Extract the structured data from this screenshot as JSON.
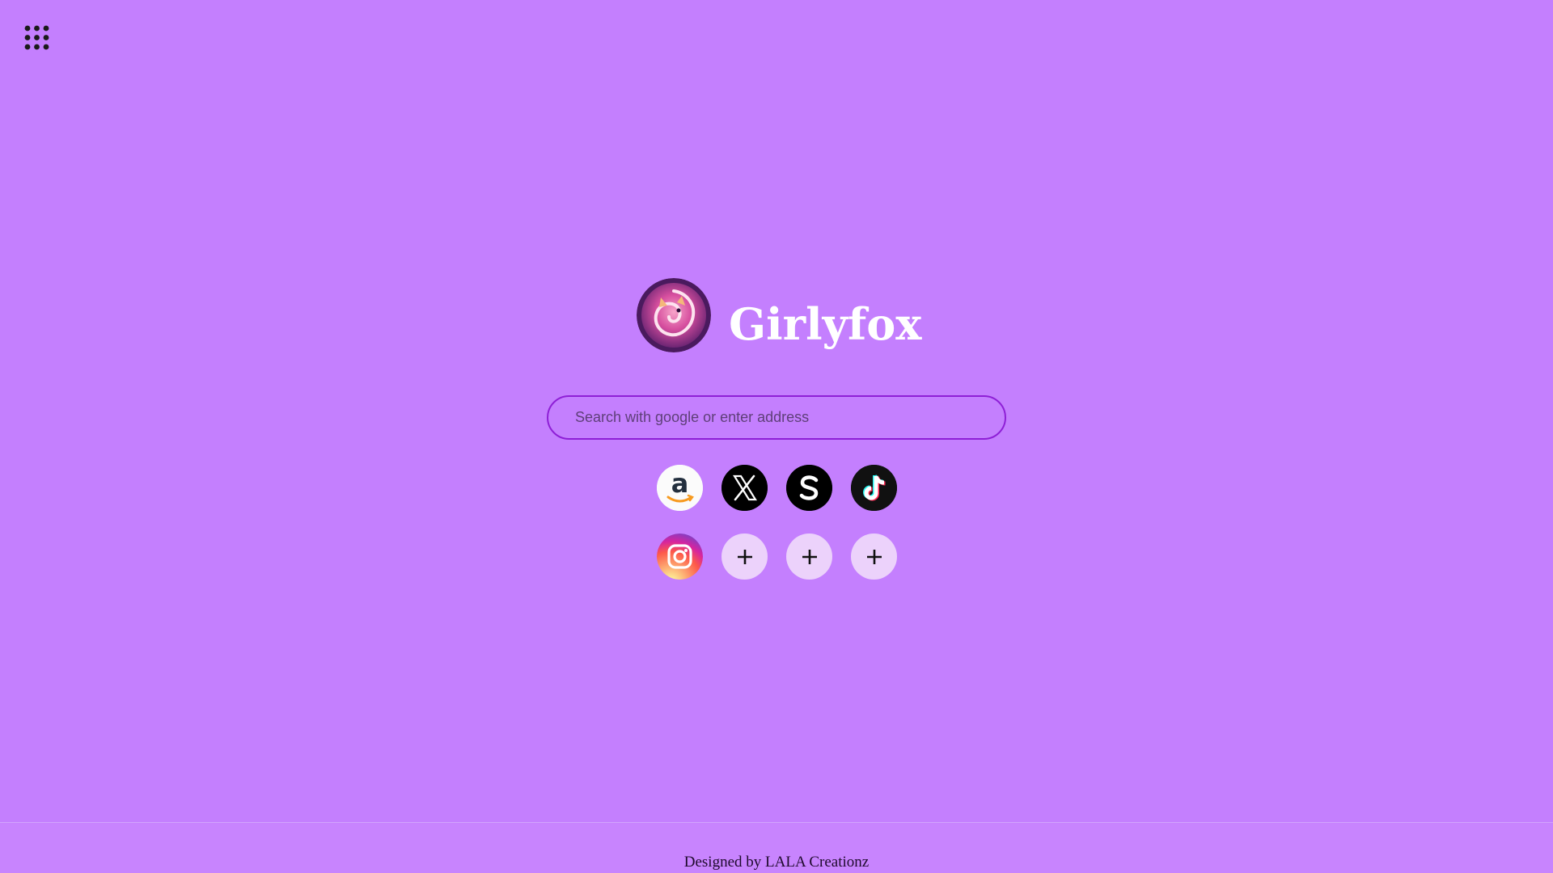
{
  "app": {
    "brand_name": "Girlyfox",
    "logo_icon": "fox-logo-icon"
  },
  "toolbar": {
    "apps_icon": "apps-grid-icon"
  },
  "search": {
    "placeholder": "Search with google or enter address",
    "value": ""
  },
  "shortcuts": [
    {
      "name": "Amazon",
      "icon": "amazon-icon"
    },
    {
      "name": "X",
      "icon": "x-icon"
    },
    {
      "name": "S",
      "icon": "s-icon"
    },
    {
      "name": "TikTok",
      "icon": "tiktok-icon"
    },
    {
      "name": "Instagram",
      "icon": "instagram-icon"
    },
    {
      "name": "add",
      "icon": "plus-icon"
    },
    {
      "name": "add",
      "icon": "plus-icon"
    },
    {
      "name": "add",
      "icon": "plus-icon"
    }
  ],
  "footer": {
    "text": "Designed by LALA Creationz"
  },
  "colors": {
    "background": "#c47ffe",
    "accent": "#8e1fd6",
    "add_tile": "#ecd2fb",
    "brand_text": "#ffffff"
  }
}
